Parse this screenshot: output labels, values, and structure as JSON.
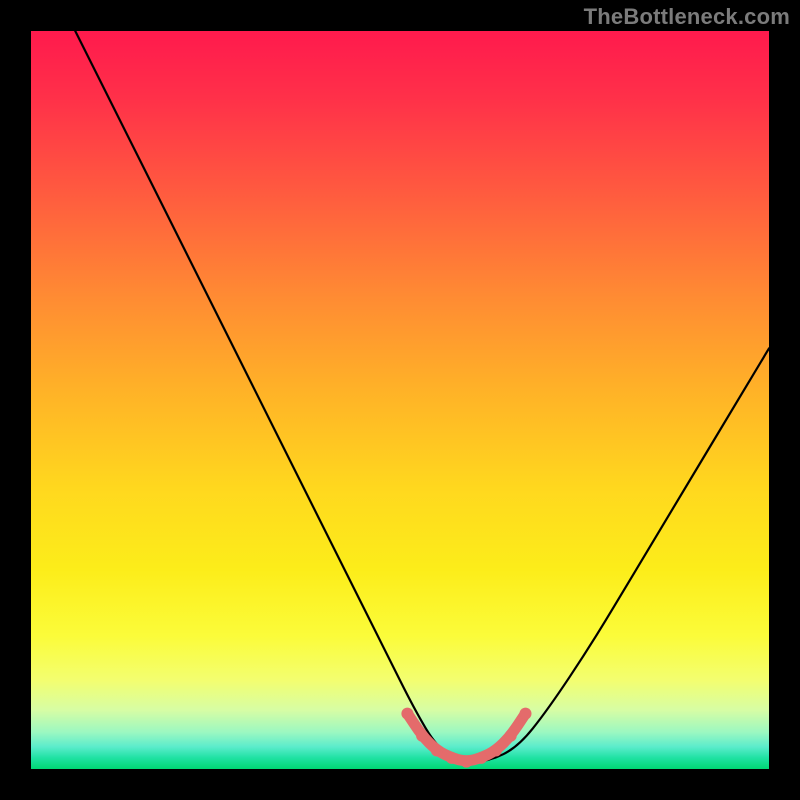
{
  "watermark": "TheBottleneck.com",
  "chart_data": {
    "type": "line",
    "title": "",
    "xlabel": "",
    "ylabel": "",
    "xlim": [
      0,
      100
    ],
    "ylim": [
      0,
      100
    ],
    "grid": false,
    "series": [
      {
        "name": "curve",
        "x": [
          0,
          6,
          12,
          18,
          24,
          30,
          36,
          42,
          48,
          52,
          55,
          58,
          62,
          66,
          70,
          76,
          82,
          88,
          94,
          100
        ],
        "y": [
          112,
          100,
          88,
          76,
          64,
          52,
          40,
          28,
          16,
          8,
          3,
          1,
          1,
          3,
          8,
          17,
          27,
          37,
          47,
          57
        ]
      }
    ],
    "valley_highlight": {
      "color": "#e46b6b",
      "x": [
        51,
        53,
        55,
        57,
        59,
        61,
        63,
        65,
        67
      ],
      "y": [
        7.5,
        4.5,
        2.5,
        1.5,
        1.0,
        1.5,
        2.5,
        4.5,
        7.5
      ]
    },
    "background_gradient": {
      "top": "#ff1a4d",
      "mid": "#ffd81e",
      "bottom": "#00d873"
    }
  }
}
